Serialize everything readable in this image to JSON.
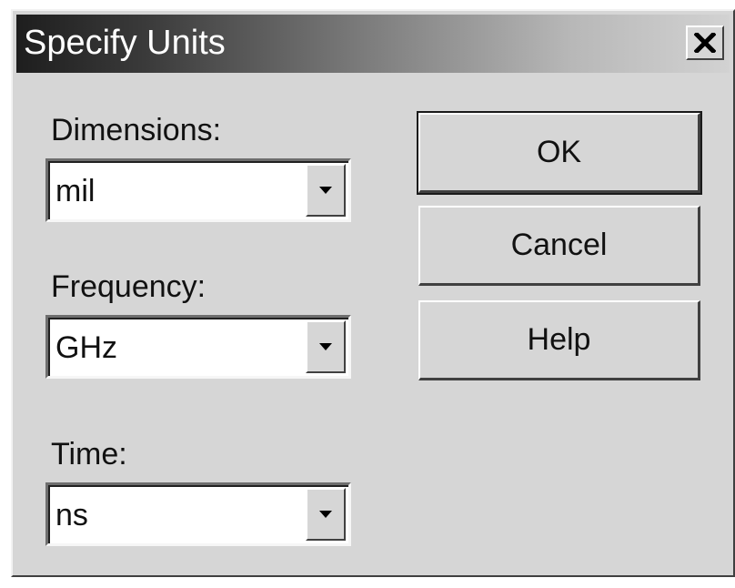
{
  "window": {
    "title": "Specify Units",
    "close_icon": "close-x-icon"
  },
  "fields": {
    "dimensions": {
      "label": "Dimensions:",
      "value": "mil"
    },
    "frequency": {
      "label": "Frequency:",
      "value": "GHz"
    },
    "time": {
      "label": "Time:",
      "value": "ns"
    }
  },
  "buttons": {
    "ok": "OK",
    "cancel": "Cancel",
    "help": "Help"
  },
  "colors": {
    "dialog_bg": "#d6d6d6",
    "titlebar_dark": "#1e1e1e",
    "titlebar_light": "#d2d2d2"
  }
}
